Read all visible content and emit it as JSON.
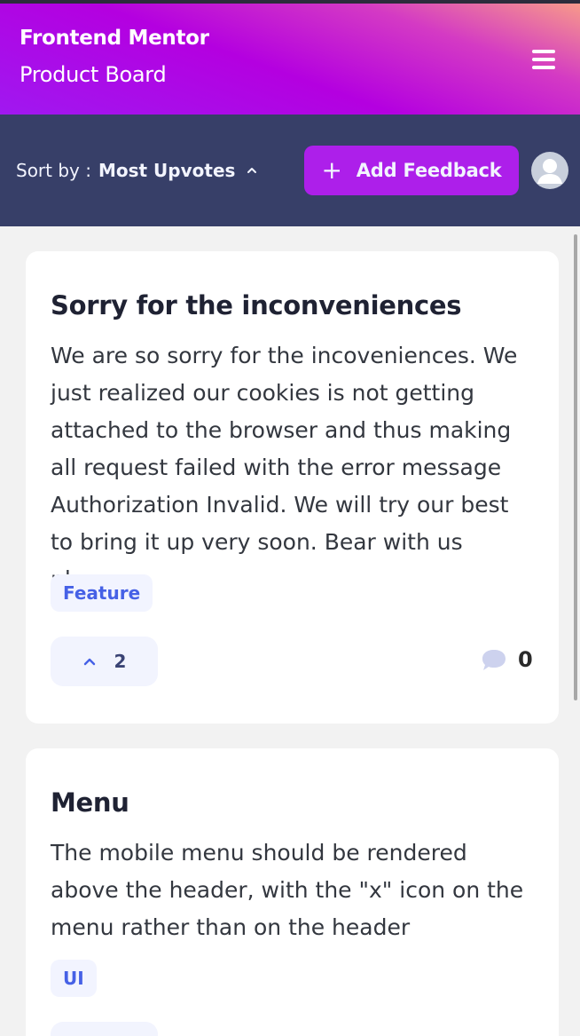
{
  "header": {
    "brand_name": "Frontend Mentor",
    "brand_sub": "Product Board"
  },
  "toolbar": {
    "sort_label": "Sort by :",
    "sort_value": "Most Upvotes",
    "add_feedback_label": "Add Feedback",
    "add_icon": "+"
  },
  "colors": {
    "accent": "#ad1fea",
    "toolbar_bg": "#373f68",
    "tag_text": "#4661e6",
    "tag_bg": "#f2f4ff",
    "page_bg": "#f2f2f2"
  },
  "feedback": [
    {
      "title": "Sorry for the inconveniences",
      "description": "We are so sorry for the incoveniences. We just realized our cookies is not getting attached to the browser and thus making all request failed with the error message Authorization Invalid. We will try our best to bring it up very soon. Bear with us please",
      "tag": "Feature",
      "upvotes": "2",
      "comments": "0"
    },
    {
      "title": "Menu",
      "description": "The mobile menu should be rendered above the header, with the \"x\" icon on the menu rather than on the header",
      "tag": "UI"
    }
  ],
  "icons": {
    "menu": "hamburger-icon",
    "sort": "chevron-up-icon",
    "avatar": "user-icon",
    "upvote": "chevron-up-icon",
    "comments": "comment-bubble-icon"
  }
}
